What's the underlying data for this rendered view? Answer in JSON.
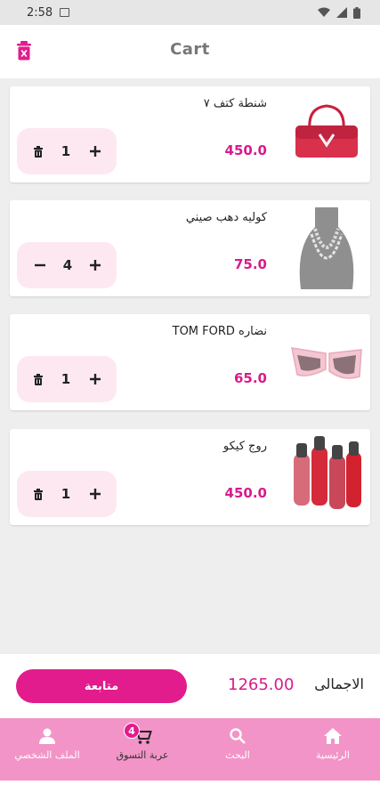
{
  "status_bar": {
    "time": "2:58"
  },
  "app_bar": {
    "title": "Cart"
  },
  "cart": {
    "items": [
      {
        "name": "شنطة كتف ٧",
        "price": "450.0",
        "quantity": "1",
        "left_action": "trash-icon"
      },
      {
        "name": "كوليه دهب صيني",
        "price": "75.0",
        "quantity": "4",
        "left_action": "minus-icon"
      },
      {
        "name": "TOM FORD نضاره",
        "price": "65.0",
        "quantity": "1",
        "left_action": "trash-icon"
      },
      {
        "name": "روج كيكو",
        "price": "450.0",
        "quantity": "1",
        "left_action": "trash-icon"
      }
    ]
  },
  "checkout": {
    "continue_label": "متابعة",
    "total_value": "1265.00",
    "total_label": "الاجمالى"
  },
  "bottom_nav": {
    "items": [
      {
        "label": "الملف الشخصي",
        "icon": "person-icon"
      },
      {
        "label": "عربة التسوق",
        "icon": "cart-icon",
        "badge": "4"
      },
      {
        "label": "البحث",
        "icon": "search-icon"
      },
      {
        "label": "الرئيسية",
        "icon": "home-icon"
      }
    ]
  },
  "colors": {
    "accent": "#e21c8d",
    "price": "#d81b8c",
    "nav_bg": "#f294c7",
    "stepper_bg": "#fde8f2"
  }
}
